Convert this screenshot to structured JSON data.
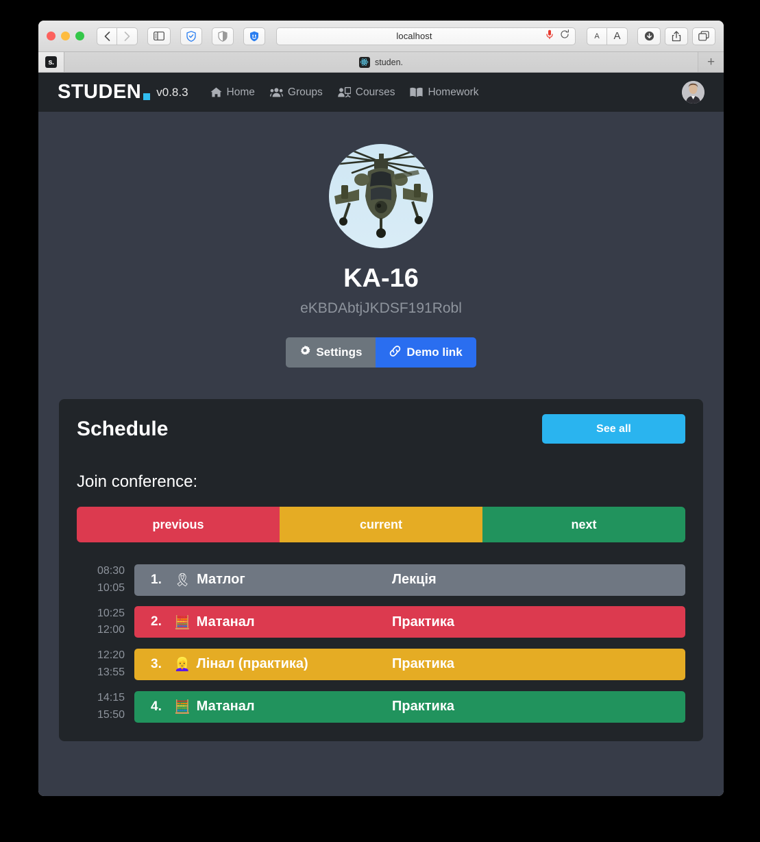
{
  "browser": {
    "url": "localhost",
    "back_icon": "chevron-left-icon",
    "forward_icon": "chevron-right-icon",
    "sidebar_icon": "sidebar-icon",
    "adblock_icon": "shield-check-icon",
    "reader_icon": "contrast-icon",
    "privacy_icon": "shield-badge-icon",
    "mic_icon": "microphone-icon",
    "reload_icon": "reload-icon",
    "font_small_label": "A",
    "font_large_label": "A",
    "download_icon": "download-icon",
    "share_icon": "share-icon",
    "tabs_icon": "tab-overview-icon",
    "new_tab_label": "+",
    "favicon_label": "s.",
    "tab_title": "studen.",
    "tab_icon": "react-logo-icon"
  },
  "navbar": {
    "logo_text": "STUDEN",
    "logo_dot": "brand-dot",
    "version": "v0.8.3",
    "links": [
      {
        "label": "Home",
        "icon": "house-icon"
      },
      {
        "label": "Groups",
        "icon": "users-icon"
      },
      {
        "label": "Courses",
        "icon": "chalkboard-user-icon"
      },
      {
        "label": "Homework",
        "icon": "book-open-icon"
      }
    ],
    "avatar": "user-avatar"
  },
  "profile": {
    "avatar_image": "helicopter-photo",
    "name": "KA-16",
    "id": "eKBDAbtjJKDSF191Robl",
    "settings_label": "Settings",
    "settings_icon": "gear-icon",
    "demo_label": "Demo link",
    "demo_icon": "link-icon"
  },
  "schedule": {
    "title": "Schedule",
    "see_all_label": "See all",
    "join_label": "Join conference:",
    "conference_buttons": [
      {
        "label": "previous",
        "color": "#dc3a4f"
      },
      {
        "label": "current",
        "color": "#e5ac24"
      },
      {
        "label": "next",
        "color": "#21935d"
      }
    ],
    "lessons": [
      {
        "start": "08:30",
        "end": "10:05",
        "num": "1.",
        "emoji": "🎗",
        "emoji_name": "ribbon-icon",
        "name": "Матлог",
        "type": "Лекція",
        "color": "gray"
      },
      {
        "start": "10:25",
        "end": "12:00",
        "num": "2.",
        "emoji": "🧮",
        "emoji_name": "abacus-icon",
        "name": "Матанал",
        "type": "Практика",
        "color": "red"
      },
      {
        "start": "12:20",
        "end": "13:55",
        "num": "3.",
        "emoji": "👱‍♀️",
        "emoji_name": "blonde-woman-icon",
        "name": "Лінал (практика)",
        "type": "Практика",
        "color": "yellow"
      },
      {
        "start": "14:15",
        "end": "15:50",
        "num": "4.",
        "emoji": "🧮",
        "emoji_name": "abacus-icon",
        "name": "Матанал",
        "type": "Практика",
        "color": "green"
      }
    ]
  },
  "colors": {
    "page_bg": "#373c48",
    "card_bg": "#212529",
    "accent_cyan": "#2ab4ef",
    "accent_blue": "#2a6ef0",
    "red": "#dc3a4f",
    "yellow": "#e5ac24",
    "green": "#21935d",
    "gray": "#6f7782"
  }
}
